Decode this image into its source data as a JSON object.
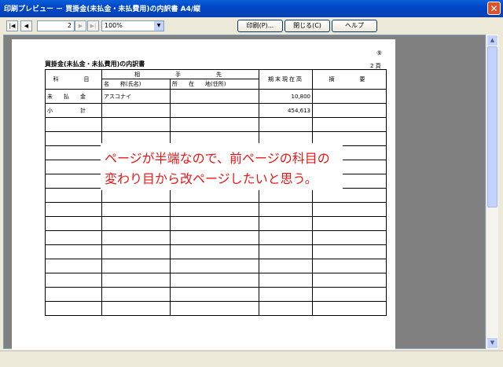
{
  "window": {
    "title": "印刷プレビュー － 買掛金(未払金・未払費用)の内訳書 A4/縦"
  },
  "toolbar": {
    "page_number": "2",
    "zoom": "100%",
    "print_label": "印刷(P)...",
    "close_label": "閉じる(C)",
    "help_label": "ヘルプ",
    "nav": {
      "first": "|◀",
      "prev": "◀",
      "next": "▶",
      "last": "▶|"
    }
  },
  "document": {
    "title": "買掛金(未払金・未払費用)の内訳書",
    "circled_number": "⑨",
    "page_label": "2 頁",
    "headers": {
      "subject": "科　　目",
      "counterparty": "相　　　手　　　先",
      "name": "名　　称(氏名)",
      "address": "所　　在　　地(住所)",
      "balance": "期末現在高",
      "remarks": "摘　　要"
    },
    "rows": [
      {
        "subject": "未　　払　　金",
        "name": "アスコナイ",
        "address": "",
        "balance": "10,800",
        "remarks": ""
      },
      {
        "subject": "小　　　　　計",
        "name": "",
        "address": "",
        "balance": "454,613",
        "remarks": ""
      }
    ],
    "empty_rows": 14
  },
  "annotation": {
    "line1": "ページが半端なので、前ページの科目の",
    "line2": "変わり目から改ページしたいと思う。",
    "color": "#e81818"
  }
}
